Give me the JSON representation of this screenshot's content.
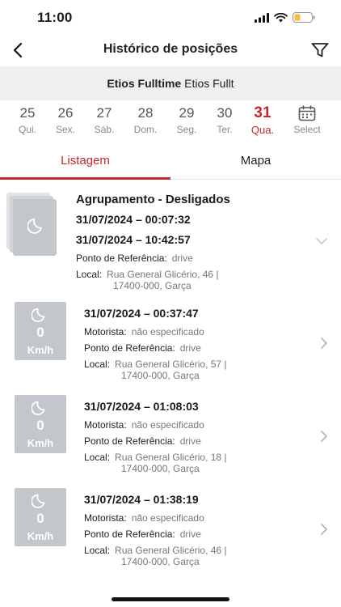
{
  "status_bar": {
    "time": "11:00"
  },
  "nav": {
    "title": "Histórico de posições"
  },
  "vehicle": {
    "name_bold": "Etios Fulltime",
    "name_regular": "Etios Fullt"
  },
  "dates": [
    {
      "num": "25",
      "day": "Qui."
    },
    {
      "num": "26",
      "day": "Sex."
    },
    {
      "num": "27",
      "day": "Sáb."
    },
    {
      "num": "28",
      "day": "Dom."
    },
    {
      "num": "29",
      "day": "Seg."
    },
    {
      "num": "30",
      "day": "Ter."
    },
    {
      "num": "31",
      "day": "Qua."
    }
  ],
  "select_label": "Select",
  "tabs": {
    "list": "Listagem",
    "map": "Mapa"
  },
  "labels": {
    "reference": "Ponto de Referência:",
    "local": "Local:",
    "driver": "Motorista:"
  },
  "group": {
    "title": "Agrupamento - Desligados",
    "start": "31/07/2024  –  00:07:32",
    "end": "31/07/2024  –  10:42:57",
    "reference": "drive",
    "address_line1": "Rua General Glicério, 46 |",
    "address_line2": "17400-000, Garça"
  },
  "items": [
    {
      "speed": "0",
      "unit": "Km/h",
      "timestamp": "31/07/2024  –  00:37:47",
      "driver": "não especificado",
      "reference": "drive",
      "address_line1": "Rua General Glicério, 57 |",
      "address_line2": "17400-000, Garça"
    },
    {
      "speed": "0",
      "unit": "Km/h",
      "timestamp": "31/07/2024  –  01:08:03",
      "driver": "não especificado",
      "reference": "drive",
      "address_line1": "Rua General Glicério, 18 |",
      "address_line2": "17400-000, Garça"
    },
    {
      "speed": "0",
      "unit": "Km/h",
      "timestamp": "31/07/2024  –  01:38:19",
      "driver": "não especificado",
      "reference": "drive",
      "address_line1": "Rua General Glicério, 46 |",
      "address_line2": "17400-000, Garça"
    }
  ],
  "colors": {
    "accent": "#c8252c",
    "thumb": "#c3c6cb",
    "vehicle_bar": "#efefef"
  },
  "icons": {
    "back": "chevron-left-icon",
    "filter": "filter-icon",
    "calendar": "calendar-icon",
    "moon": "moon-icon",
    "chevron_right": "chevron-right-icon",
    "chevron_down": "chevron-down-icon"
  }
}
